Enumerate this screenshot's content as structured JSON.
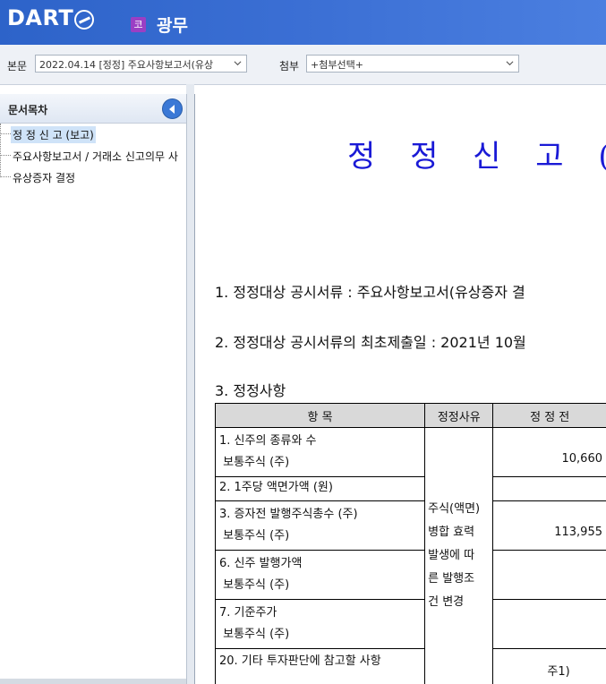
{
  "header": {
    "logo_text": "DART",
    "company_badge": "코",
    "company_name": "광무"
  },
  "toolbar": {
    "main_label": "본문",
    "main_select_value": "2022.04.14  [정정] 주요사항보고서(유상",
    "attach_label": "첨부",
    "attach_select_value": "+첨부선택+"
  },
  "toc": {
    "title": "문서목차",
    "items": [
      {
        "label": "정 정 신 고 (보고)",
        "selected": true
      },
      {
        "label": "주요사항보고서 / 거래소 신고의무 사",
        "selected": false
      },
      {
        "label": "유상증자 결정",
        "selected": false
      }
    ]
  },
  "document": {
    "title": "정 정 신 고 (보고",
    "line1": "1. 정정대상 공시서류 : 주요사항보고서(유상증자 결",
    "line2": "2. 정정대상 공시서류의 최초제출일 : 2021년  10월",
    "line3": "3. 정정사항",
    "table": {
      "headers": [
        "항 목",
        "정정사유",
        "정 정 전"
      ],
      "reason": "주식(액면)병합 효력 발생에 따른 발행조건 변경",
      "reason_lines": [
        "주식(액면)",
        "병합 효력",
        "발생에 따",
        "른 발행조",
        "건 변경"
      ],
      "rows": [
        {
          "item_lines": [
            "1. 신주의 종류와 수",
            " 보통주식 (주)"
          ],
          "before": "10,660"
        },
        {
          "item_lines": [
            "2. 1주당 액면가액 (원)"
          ],
          "before": ""
        },
        {
          "item_lines": [
            "3. 증자전 발행주식총수 (주)",
            " 보통주식 (주)"
          ],
          "before": "113,955"
        },
        {
          "item_lines": [
            "6. 신주 발행가액",
            " 보통주식 (주)"
          ],
          "before": ""
        },
        {
          "item_lines": [
            "7. 기준주가",
            " 보통주식 (주)"
          ],
          "before": ""
        },
        {
          "item_lines": [
            "20. 기타 투자판단에 참고할 사항"
          ],
          "before": "주1)"
        }
      ]
    }
  },
  "colors": {
    "header_bg": "#3b6fd4",
    "title_blue": "#1a1ad6",
    "badge_purple": "#9b3fc4",
    "selection": "#cfe3f8"
  }
}
